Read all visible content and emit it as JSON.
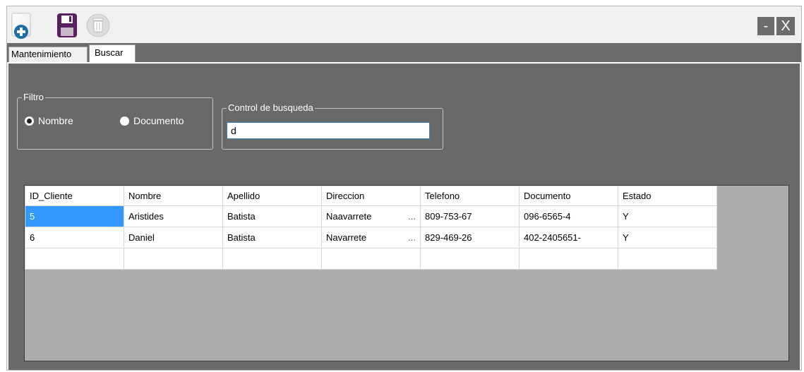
{
  "toolbar": {
    "new_icon": "new-record-icon",
    "save_icon": "save-floppy-icon",
    "delete_icon": "delete-trash-icon"
  },
  "window_controls": {
    "minimize": "-",
    "close": "X"
  },
  "tabs": [
    {
      "label": "Mantenimiento",
      "active": false
    },
    {
      "label": "Buscar",
      "active": true
    }
  ],
  "filter": {
    "legend": "Filtro",
    "options": [
      {
        "label": "Nombre",
        "selected": true
      },
      {
        "label": "Documento",
        "selected": false
      }
    ]
  },
  "search": {
    "legend": "Control de busqueda",
    "value": "d"
  },
  "grid": {
    "columns": [
      "ID_Cliente",
      "Nombre",
      "Apellido",
      "Direccion",
      "Telefono",
      "Documento",
      "Estado"
    ],
    "rows": [
      [
        "5",
        "Aristides",
        "Batista",
        "Naavarrete",
        "809-753-67",
        "096-6565-4",
        "Y"
      ],
      [
        "6",
        "Daniel",
        "Batista",
        "Navarrete",
        "829-469-26",
        "402-2405651-",
        "Y"
      ]
    ],
    "ellipsis": "..."
  },
  "colors": {
    "panel_bg": "#696969",
    "selection": "#3399ff",
    "grid_bg": "#ababab"
  }
}
